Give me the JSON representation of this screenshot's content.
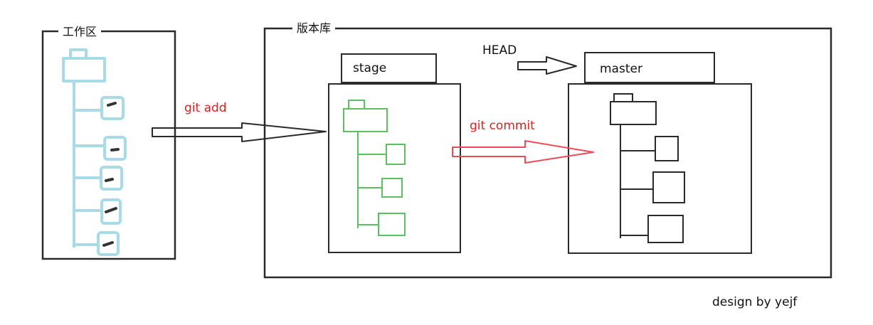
{
  "workspace": {
    "label": "工作区"
  },
  "repository": {
    "label": "版本库"
  },
  "stage": {
    "label": "stage"
  },
  "master": {
    "label": "master"
  },
  "head": {
    "label": "HEAD"
  },
  "arrows": {
    "git_add": "git add",
    "git_commit": "git commit"
  },
  "footer": {
    "credit": "design by yejf"
  },
  "colors": {
    "workspace_tree": "#a8dbe6",
    "stage_tree": "#5cc063",
    "commit_arrow": "#ee4b55",
    "outline": "#2a2a2a"
  }
}
